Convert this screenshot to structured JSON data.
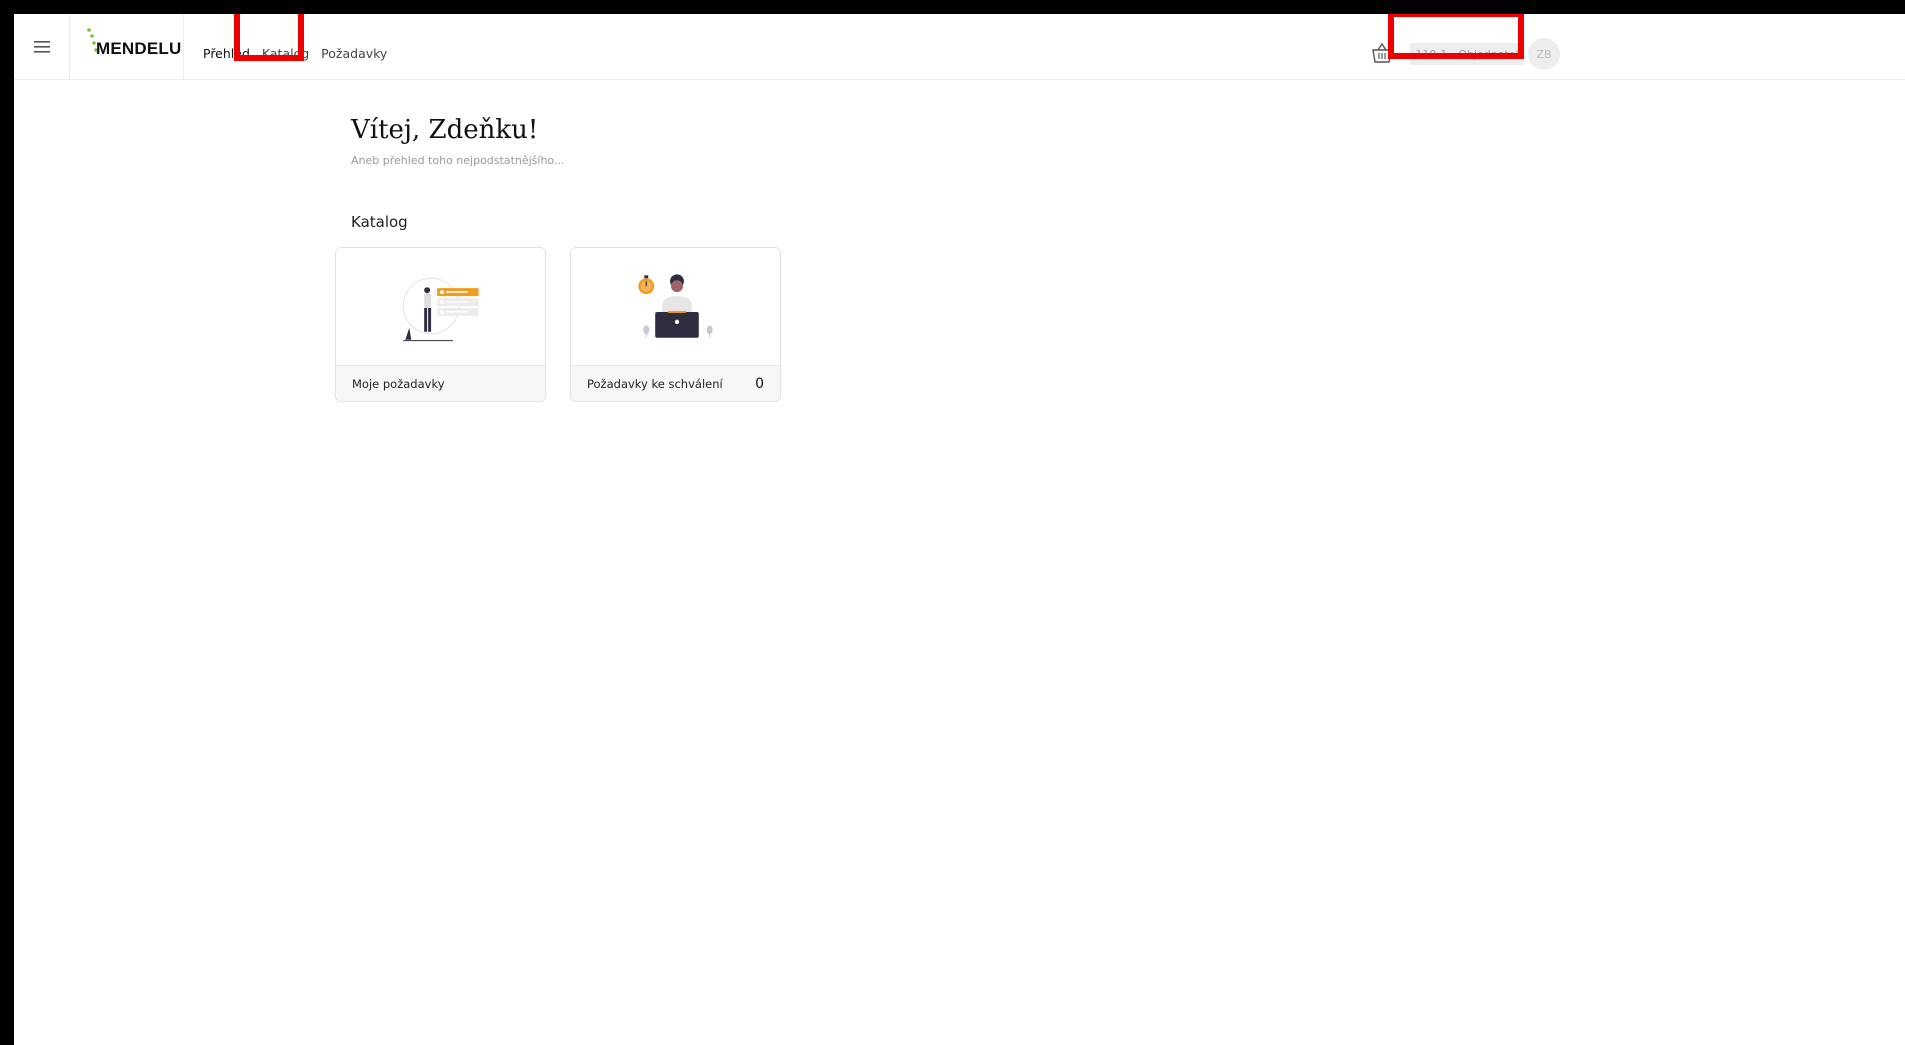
{
  "header": {
    "logo_text": "MENDELU",
    "nav": [
      {
        "label": "Přehled"
      },
      {
        "label": "Katalog"
      },
      {
        "label": "Požadavky"
      }
    ],
    "role": "110-1 - Objednatel",
    "avatar_initials": "ZB"
  },
  "main": {
    "greeting": "Vítej, Zdeňku!",
    "subtitle": "Aneb přehled toho nejpodstatnějšího...",
    "section_title": "Katalog",
    "cards": [
      {
        "label": "Moje požadavky"
      },
      {
        "label": "Požadavky ke schválení",
        "count": "0"
      }
    ]
  },
  "colors": {
    "highlight": "#ee0000",
    "accent_orange": "#f29c1f",
    "logo_green": "#79c142"
  }
}
